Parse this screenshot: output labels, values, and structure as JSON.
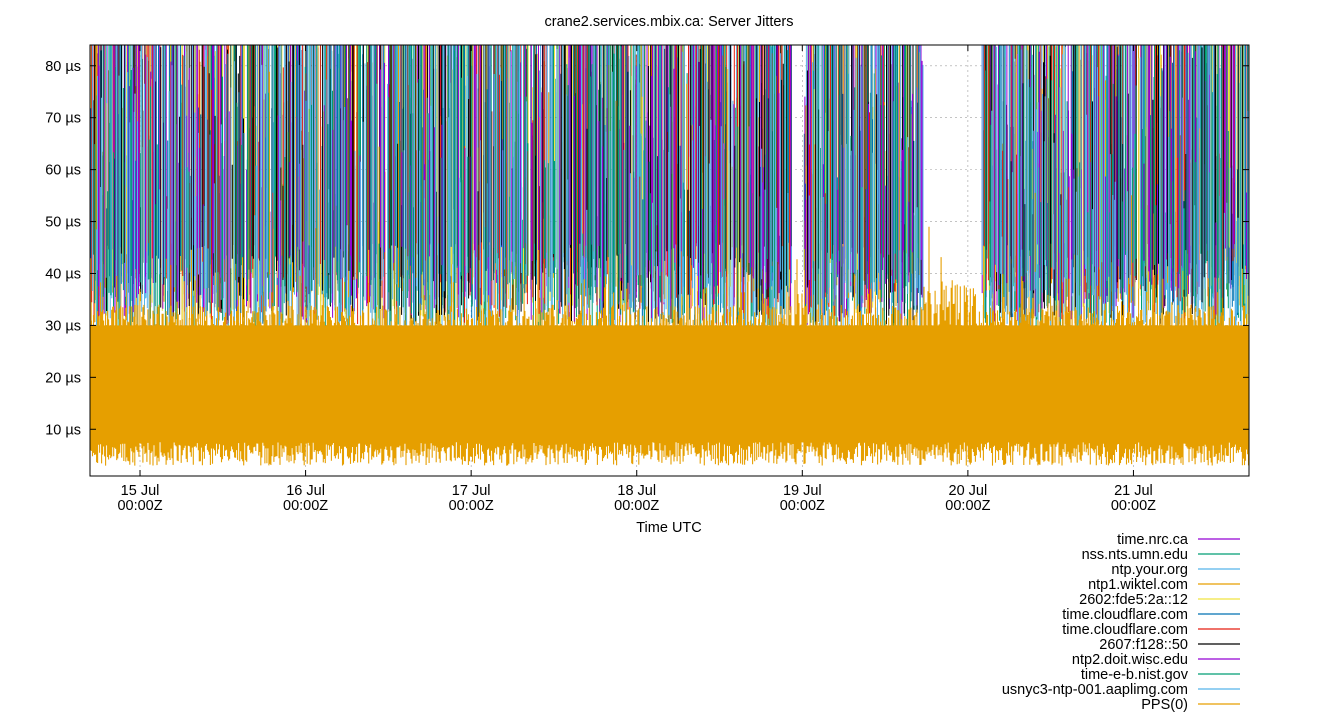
{
  "chart_data": {
    "type": "line",
    "title": "crane2.services.mbix.ca: Server Jitters",
    "xlabel": "Time UTC",
    "ylabel": "",
    "y_unit": "µs",
    "ylim": [
      1,
      84
    ],
    "y_ticks": [
      {
        "value": 10,
        "label": "10 µs"
      },
      {
        "value": 20,
        "label": "20 µs"
      },
      {
        "value": 30,
        "label": "30 µs"
      },
      {
        "value": 40,
        "label": "40 µs"
      },
      {
        "value": 50,
        "label": "50 µs"
      },
      {
        "value": 60,
        "label": "60 µs"
      },
      {
        "value": 70,
        "label": "70 µs"
      },
      {
        "value": 80,
        "label": "80 µs"
      }
    ],
    "xlim": [
      "2025-07-14T16:45Z",
      "2025-07-21T16:45Z"
    ],
    "x_ticks": [
      {
        "value": "2025-07-15T00:00Z",
        "label_day": "15 Jul",
        "label_time": "00:00Z"
      },
      {
        "value": "2025-07-16T00:00Z",
        "label_day": "16 Jul",
        "label_time": "00:00Z"
      },
      {
        "value": "2025-07-17T00:00Z",
        "label_day": "17 Jul",
        "label_time": "00:00Z"
      },
      {
        "value": "2025-07-18T00:00Z",
        "label_day": "18 Jul",
        "label_time": "00:00Z"
      },
      {
        "value": "2025-07-19T00:00Z",
        "label_day": "19 Jul",
        "label_time": "00:00Z"
      },
      {
        "value": "2025-07-20T00:00Z",
        "label_day": "20 Jul",
        "label_time": "00:00Z"
      },
      {
        "value": "2025-07-21T00:00Z",
        "label_day": "21 Jul",
        "label_time": "00:00Z"
      }
    ],
    "grid": true,
    "legend_position": "bottom-right",
    "series_style": "dense impulses",
    "server_gaps": [
      [
        "2025-07-18T22:30Z",
        "2025-07-19T00:15Z"
      ],
      [
        "2025-07-19T17:30Z",
        "2025-07-20T02:00Z"
      ]
    ],
    "series": [
      {
        "name": "time.nrc.ca",
        "color": "#9400d3",
        "typical_range": [
          30,
          84
        ]
      },
      {
        "name": "nss.nts.umn.edu",
        "color": "#009e73",
        "typical_range": [
          28,
          84
        ]
      },
      {
        "name": "ntp.your.org",
        "color": "#56b4e9",
        "typical_range": [
          25,
          84
        ]
      },
      {
        "name": "ntp1.wiktel.com",
        "color": "#e69f00",
        "typical_range": [
          25,
          84
        ]
      },
      {
        "name": "2602:fde5:2a::12",
        "color": "#f0e442",
        "typical_range": [
          30,
          84
        ]
      },
      {
        "name": "time.cloudflare.com",
        "color": "#0072b2",
        "typical_range": [
          30,
          84
        ]
      },
      {
        "name": "time.cloudflare.com",
        "color": "#e51e10",
        "typical_range": [
          30,
          84
        ]
      },
      {
        "name": "2607:f128::50",
        "color": "#000000",
        "typical_range": [
          30,
          84
        ]
      },
      {
        "name": "ntp2.doit.wisc.edu",
        "color": "#9400d3",
        "typical_range": [
          30,
          84
        ]
      },
      {
        "name": "time-e-b.nist.gov",
        "color": "#009e73",
        "typical_range": [
          28,
          84
        ]
      },
      {
        "name": "usnyc3-ntp-001.aaplimg.com",
        "color": "#56b4e9",
        "typical_range": [
          25,
          84
        ]
      },
      {
        "name": "PPS(0)",
        "color": "#e69f00",
        "typical_range": [
          3,
          40
        ]
      }
    ]
  }
}
